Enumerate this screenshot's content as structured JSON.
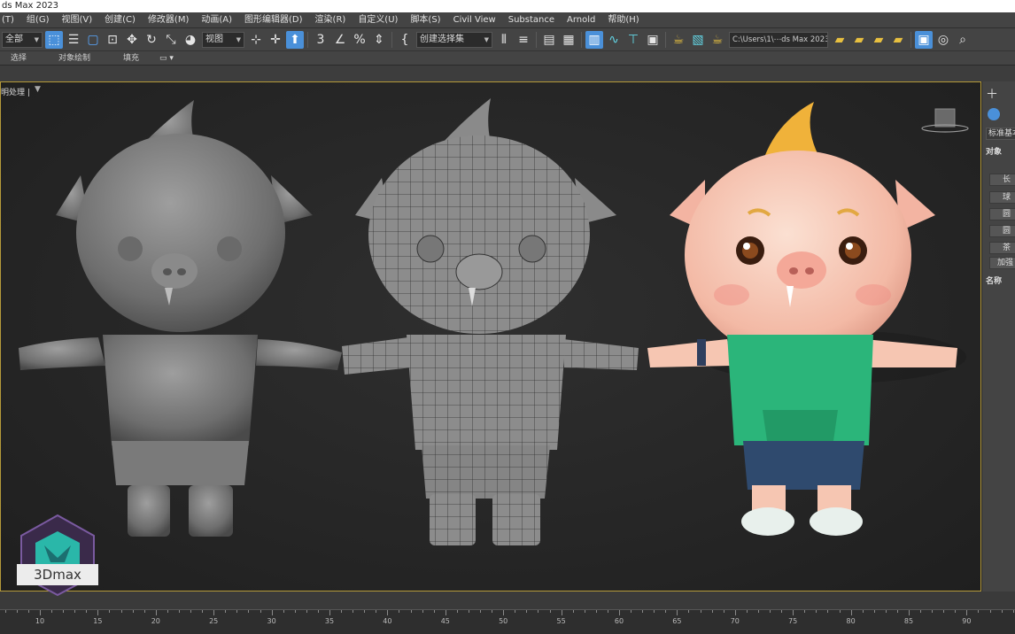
{
  "window": {
    "title": "ds Max 2023"
  },
  "menu": [
    {
      "label": "(T)"
    },
    {
      "label": "组(G)"
    },
    {
      "label": "视图(V)"
    },
    {
      "label": "创建(C)"
    },
    {
      "label": "修改器(M)"
    },
    {
      "label": "动画(A)"
    },
    {
      "label": "图形编辑器(D)"
    },
    {
      "label": "渲染(R)"
    },
    {
      "label": "自定义(U)"
    },
    {
      "label": "脚本(S)"
    },
    {
      "label": "Civil View"
    },
    {
      "label": "Substance"
    },
    {
      "label": "Arnold"
    },
    {
      "label": "帮助(H)"
    }
  ],
  "toolbar": {
    "selection_filter": "全部",
    "reference_coord": "视图",
    "named_selection": "创建选择集",
    "project_path": "C:\\Users\\1\\⋯ds Max 2023"
  },
  "ribbon": {
    "tabs": [
      "选择",
      "对象绘制",
      "填充"
    ]
  },
  "viewport": {
    "label": "明处理 |",
    "filter_icon": "funnel-icon"
  },
  "command_panel": {
    "category": "标准基本",
    "rollout_object_type": "对象",
    "buttons": [
      "长",
      "球",
      "圆",
      "圆",
      "茶",
      "加强"
    ],
    "rollout_name": "名称"
  },
  "timeline": {
    "ticks": [
      10,
      15,
      20,
      25,
      30,
      35,
      40,
      45,
      50,
      55,
      60,
      65,
      70,
      75,
      80,
      85,
      90
    ]
  },
  "watermark": {
    "label": "3Dmax"
  },
  "colors": {
    "accent": "#4a90d9",
    "viewport_border": "#b59a3a",
    "shirt": "#2bb57a",
    "shorts": "#2f4a6e",
    "hair": "#f0b23a",
    "skin": "#f6c9b9",
    "logo": "#2ab7a9"
  }
}
